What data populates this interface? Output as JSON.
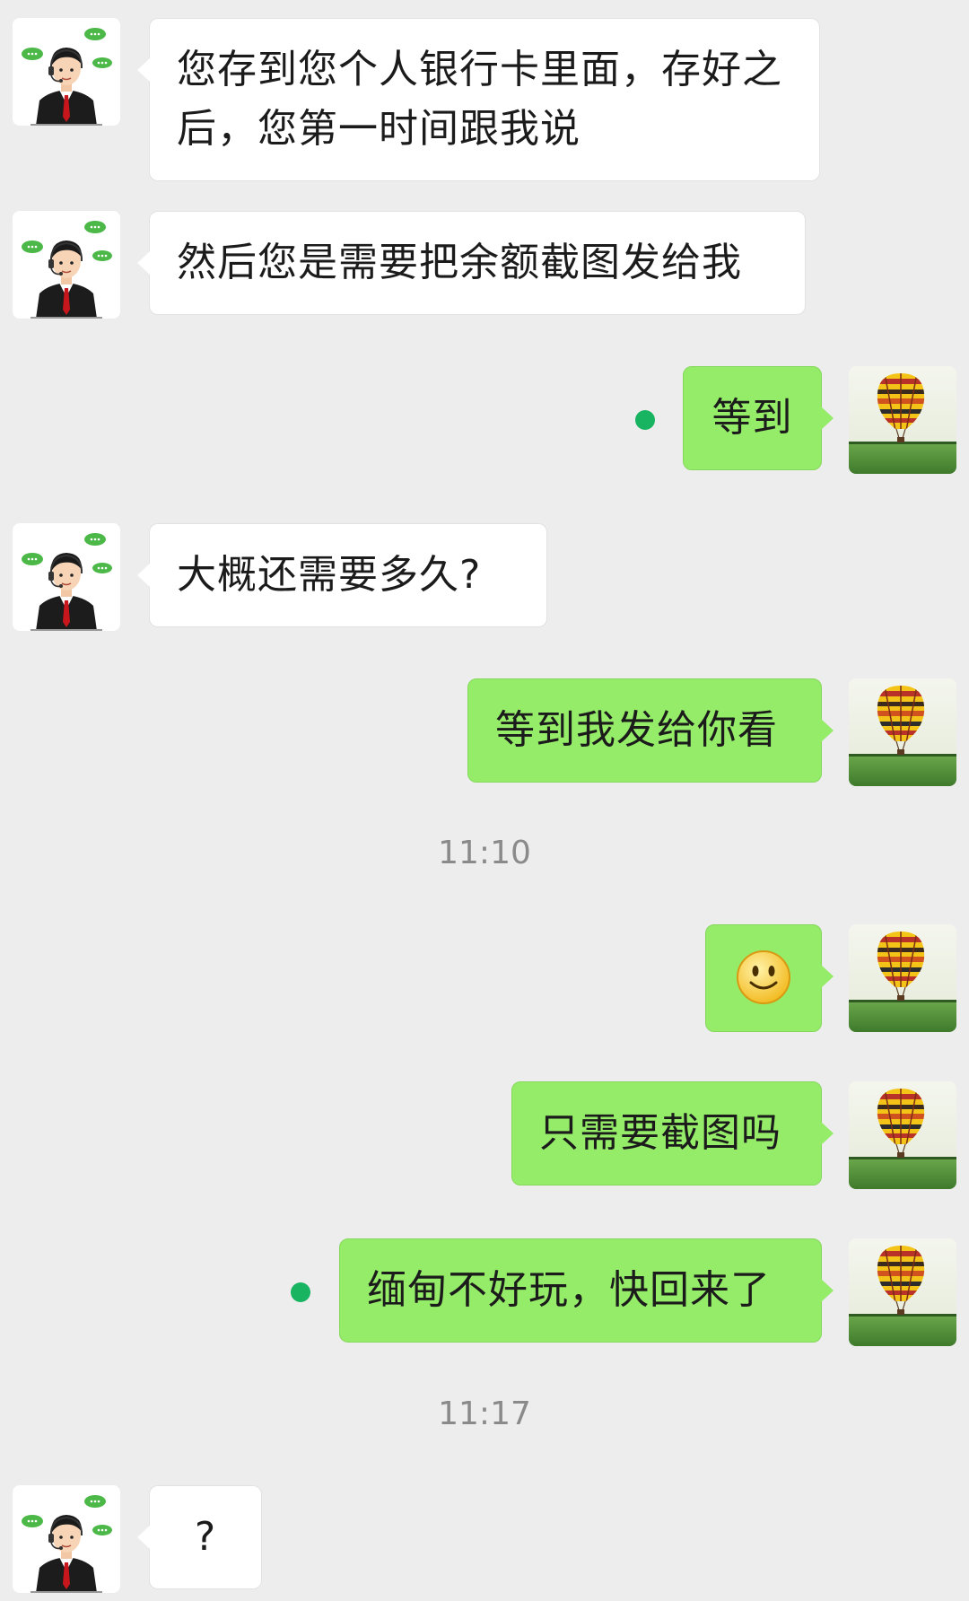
{
  "messages": [
    {
      "side": "in",
      "text": "您存到您个人银行卡里面，存好之后，您第一时间跟我说"
    },
    {
      "side": "in",
      "text": "然后您是需要把余额截图发给我"
    },
    {
      "side": "out",
      "text": "等到",
      "unread_dot": true
    },
    {
      "side": "in",
      "text": "大概还需要多久?"
    },
    {
      "side": "out",
      "text": "等到我发给你看"
    },
    {
      "side": "out",
      "emoji": "smile-emoji"
    },
    {
      "side": "out",
      "text": "只需要截图吗"
    },
    {
      "side": "out",
      "text": "缅甸不好玩，快回来了",
      "unread_dot": true
    },
    {
      "side": "in",
      "text": "?"
    }
  ],
  "timestamps": [
    "11:10",
    "11:17"
  ],
  "colors": {
    "background": "#ededed",
    "incoming_bubble": "#ffffff",
    "outgoing_bubble": "#95ec69",
    "unread_dot": "#19b462",
    "timestamp_text": "#8a8a8a"
  },
  "avatars": {
    "contact": "agent-headset-avatar",
    "self": "hot-air-balloon-avatar"
  }
}
